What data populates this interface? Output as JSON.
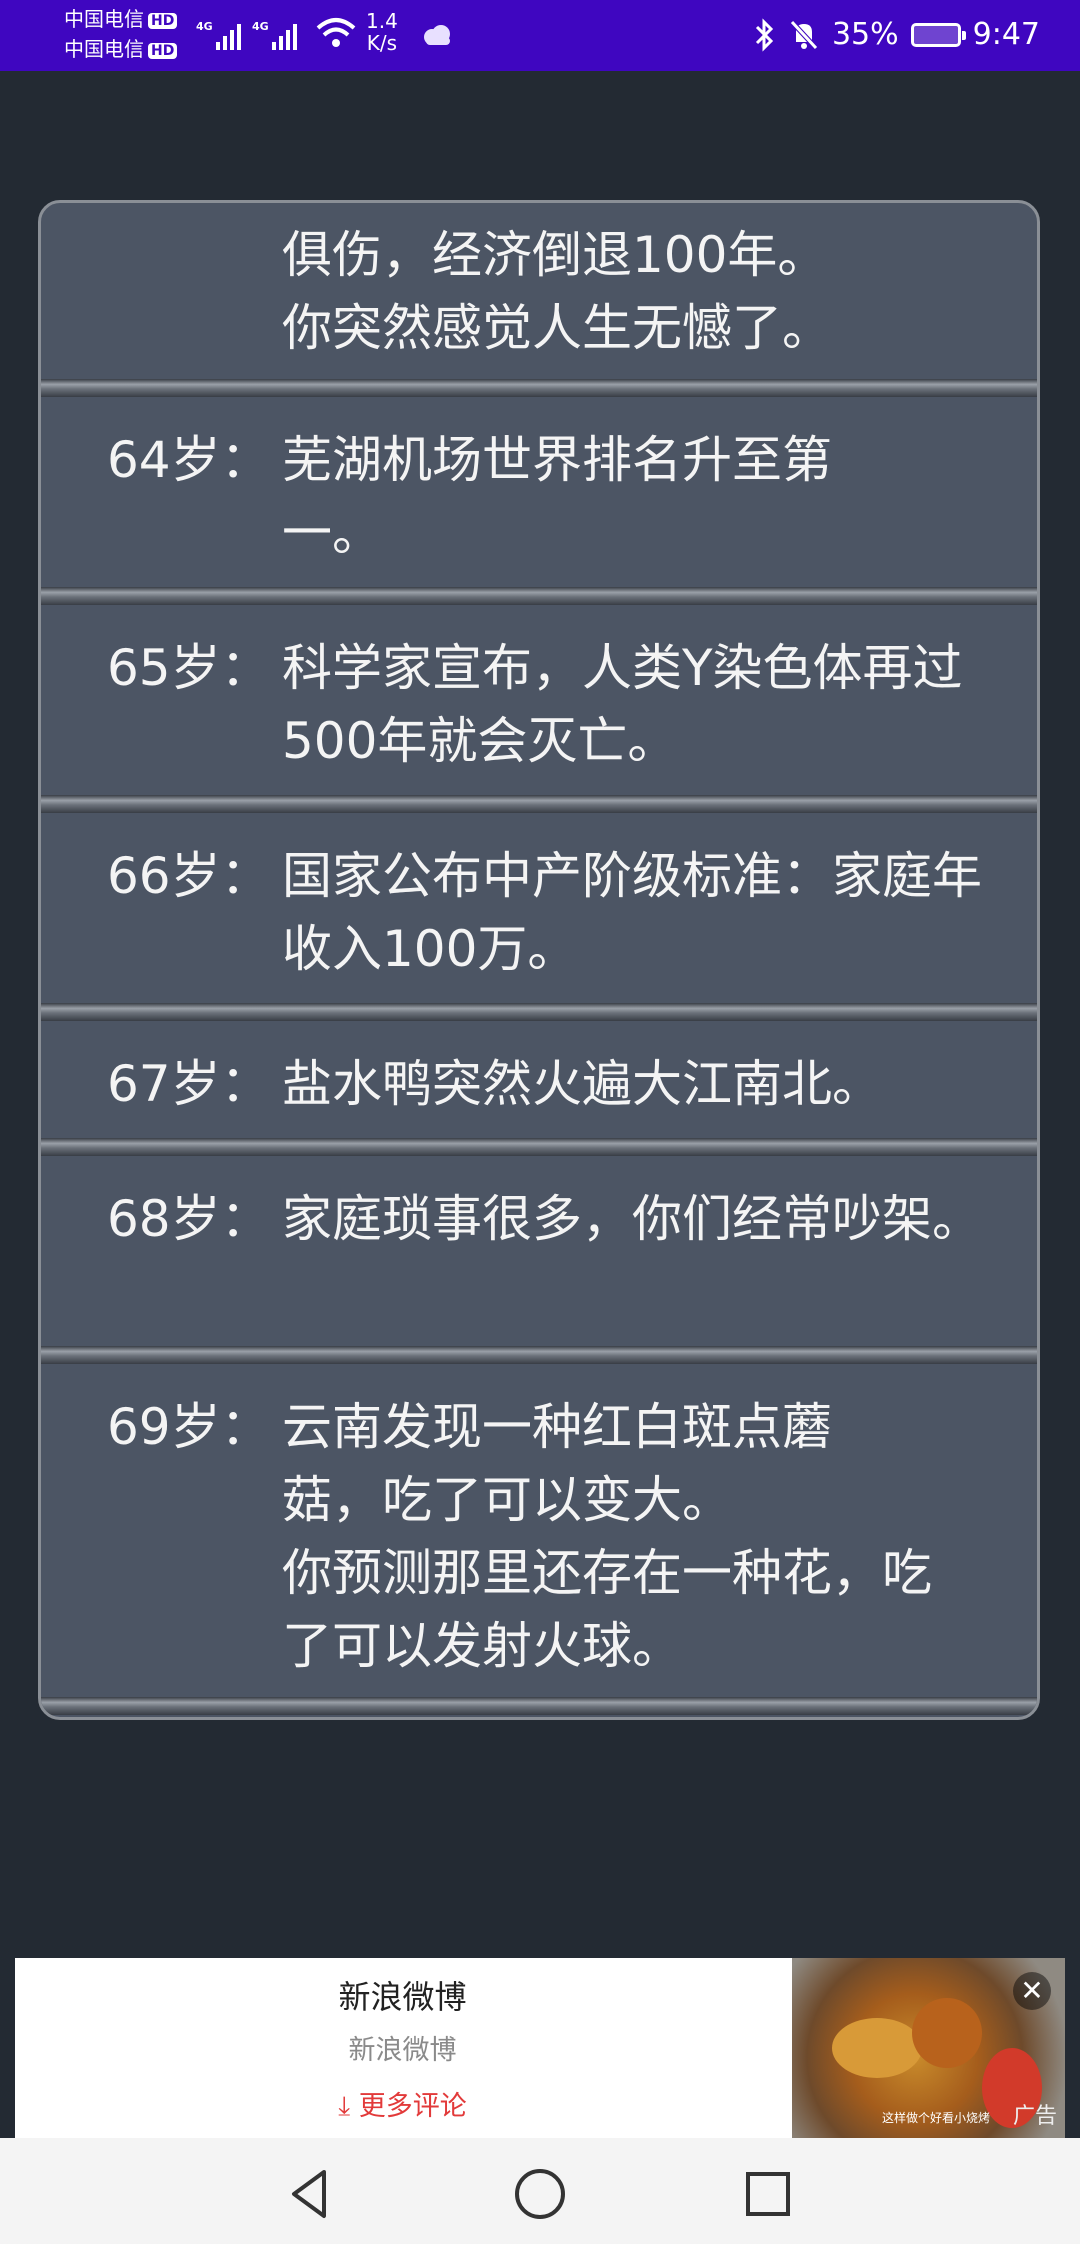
{
  "status_bar": {
    "carrier1": "中国电信",
    "carrier2": "中国电信",
    "hd": "HD",
    "net1": "4G",
    "net2": "4G",
    "speed_value": "1.4",
    "speed_unit": "K/s",
    "battery": "35%",
    "time": "9:47"
  },
  "entries": [
    {
      "age": "",
      "text": "俱伤，经济倒退100年。\n你突然感觉人生无憾了。"
    },
    {
      "age": "64岁：",
      "text": "芜湖机场世界排名升至第一。"
    },
    {
      "age": "65岁：",
      "text": "科学家宣布，人类Y染色体再过500年就会灭亡。"
    },
    {
      "age": "66岁：",
      "text": "国家公布中产阶级标准：家庭年收入100万。"
    },
    {
      "age": "67岁：",
      "text": "盐水鸭突然火遍大江南北。"
    },
    {
      "age": "68岁：",
      "text": "家庭琐事很多，你们经常吵架。"
    },
    {
      "age": "69岁：",
      "text": "云南发现一种红白斑点蘑菇，吃了可以变大。\n你预测那里还存在一种花，吃了可以发射火球。"
    }
  ],
  "ad": {
    "title": "新浪微博",
    "subtitle": "新浪微博",
    "more": "更多评论",
    "image_caption": "这样做个好看小烧烤",
    "tag": "广告"
  },
  "icons": {
    "back": "back-triangle-icon",
    "home": "home-circle-icon",
    "recents": "recents-square-icon"
  }
}
